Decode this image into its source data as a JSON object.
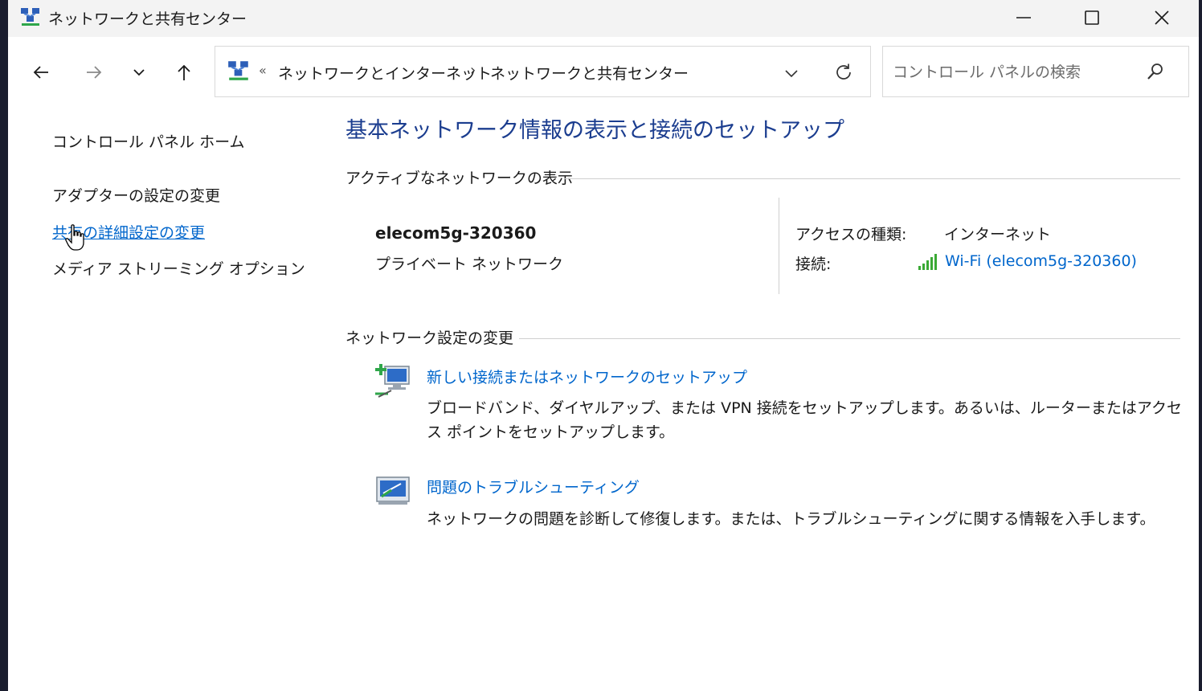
{
  "window": {
    "title": "ネットワークと共有センター",
    "icon": "network-center-icon",
    "controls": [
      "minimize-icon",
      "maximize-icon",
      "close-icon"
    ]
  },
  "nav": {
    "back": "arrow-left-icon",
    "forward": "arrow-right-icon",
    "recent": "chevron-down-icon",
    "up": "arrow-up-icon"
  },
  "address": {
    "overflow": "«",
    "crumbs": [
      "ネットワークとインターネット",
      "ネットワークと共有センター"
    ],
    "separator": "›"
  },
  "search": {
    "placeholder": "コントロール パネルの検索"
  },
  "sidebar": {
    "items": [
      {
        "label": "コントロール パネル ホーム"
      },
      {
        "label": "アダプターの設定の変更"
      },
      {
        "label": "共有の詳細設定の変更"
      },
      {
        "label": "メディア ストリーミング オプション"
      }
    ]
  },
  "main": {
    "title": "基本ネットワーク情報の表示と接続のセットアップ",
    "active_section": "アクティブなネットワークの表示",
    "network": {
      "name": "elecom5g-320360",
      "type": "プライベート ネットワーク",
      "access_label": "アクセスの種類:",
      "access_value": "インターネット",
      "conn_label": "接続:",
      "conn_value": "Wi-Fi (elecom5g-320360)"
    },
    "change_section": "ネットワーク設定の変更",
    "tasks": [
      {
        "link": "新しい接続またはネットワークのセットアップ",
        "desc": "ブロードバンド、ダイヤルアップ、または VPN 接続をセットアップします。あるいは、ルーターまたはアクセス ポイントをセットアップします。",
        "icon": "new-connection-icon"
      },
      {
        "link": "問題のトラブルシューティング",
        "desc": "ネットワークの問題を診断して修復します。または、トラブルシューティングに関する情報を入手します。",
        "icon": "troubleshoot-icon"
      }
    ]
  },
  "colors": {
    "title_blue": "#1b3d8f",
    "link_blue": "#0066cc",
    "signal_green": "#3aa935"
  }
}
